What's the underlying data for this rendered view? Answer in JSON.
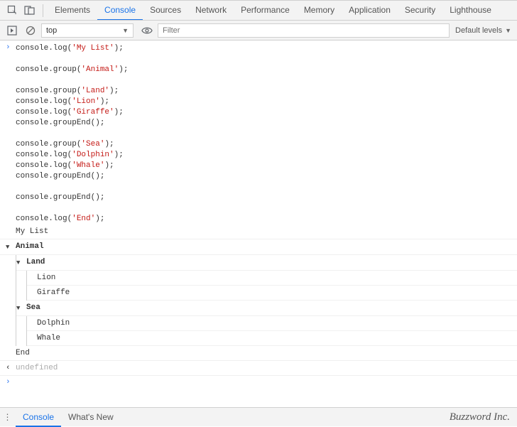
{
  "tabs": [
    "Elements",
    "Console",
    "Sources",
    "Network",
    "Performance",
    "Memory",
    "Application",
    "Security",
    "Lighthouse"
  ],
  "activeTab": "Console",
  "toolbar": {
    "context": "top",
    "filter_placeholder": "Filter",
    "levels_label": "Default levels"
  },
  "code_lines": [
    [
      "console.log(",
      "'My List'",
      ");"
    ],
    [
      ""
    ],
    [
      "console.group(",
      "'Animal'",
      ");"
    ],
    [
      ""
    ],
    [
      "console.group(",
      "'Land'",
      ");"
    ],
    [
      "console.log(",
      "'Lion'",
      ");"
    ],
    [
      "console.log(",
      "'Giraffe'",
      ");"
    ],
    [
      "console.groupEnd();"
    ],
    [
      ""
    ],
    [
      "console.group(",
      "'Sea'",
      ");"
    ],
    [
      "console.log(",
      "'Dolphin'",
      ");"
    ],
    [
      "console.log(",
      "'Whale'",
      ");"
    ],
    [
      "console.groupEnd();"
    ],
    [
      ""
    ],
    [
      "console.groupEnd();"
    ],
    [
      ""
    ],
    [
      "console.log(",
      "'End'",
      ");"
    ]
  ],
  "output": {
    "pre": "My List",
    "group": {
      "label": "Animal",
      "children": [
        {
          "label": "Land",
          "items": [
            "Lion",
            "Giraffe"
          ]
        },
        {
          "label": "Sea",
          "items": [
            "Dolphin",
            "Whale"
          ]
        }
      ]
    },
    "post": "End",
    "return": "undefined"
  },
  "bottom_tabs": [
    "Console",
    "What's New"
  ],
  "bottom_active": "Console",
  "brand": "Buzzword Inc."
}
